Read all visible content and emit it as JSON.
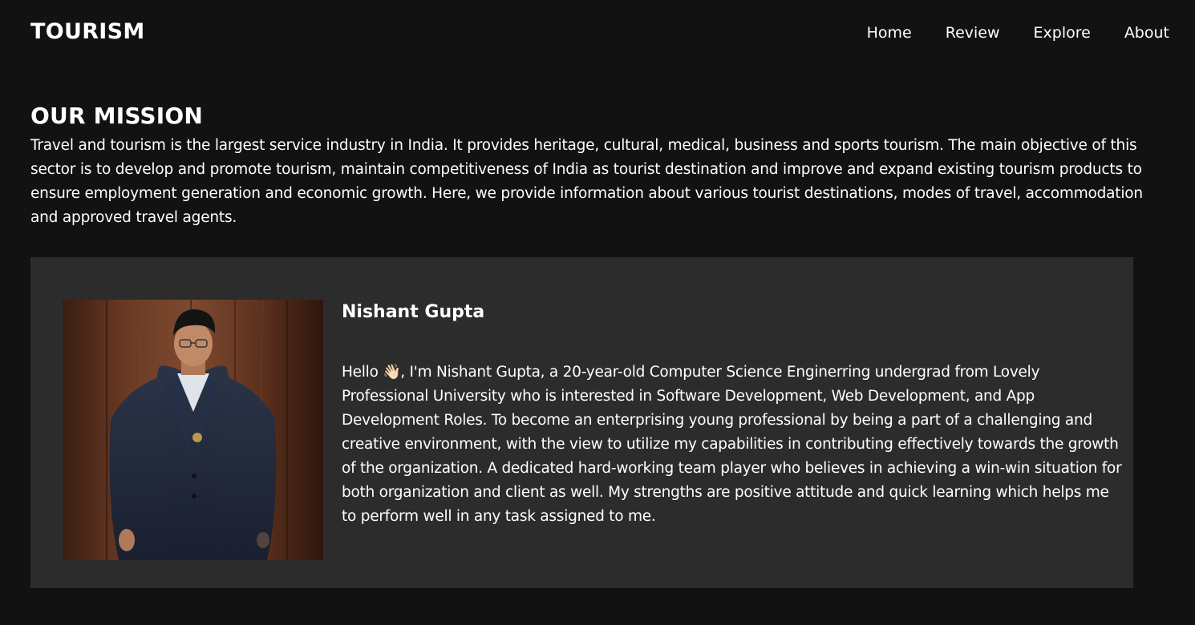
{
  "navbar": {
    "brand": "TOURISM",
    "links": [
      "Home",
      "Review",
      "Explore",
      "About"
    ]
  },
  "mission": {
    "title": "OUR MISSION",
    "text": "Travel and tourism is the largest service industry in India. It provides heritage, cultural, medical, business and sports tourism. The main objective of this sector is to develop and promote tourism, maintain competitiveness of India as tourist destination and improve and expand existing tourism products to ensure employment generation and economic growth. Here, we provide information about various tourist destinations, modes of travel, accommodation and approved travel agents."
  },
  "profile": {
    "name": "Nishant Gupta",
    "bio_greeting": "Hello ",
    "bio_emoji": "👋🏻",
    "bio_text": ", I'm Nishant Gupta, a 20-year-old Computer Science Enginerring undergrad from Lovely Professional University who is interested in Software Development, Web Development, and App Development Roles. To become an enterprising young professional by being a part of a challenging and creative environment, with the view to utilize my capabilities in contributing effectively towards the growth of the organization. A dedicated hard-working team player who believes in achieving a win-win situation for both organization and client as well. My strengths are positive attitude and quick learning which helps me to perform well in any task assigned to me.",
    "photo_icon": "person-photo"
  },
  "colors": {
    "page_background": "#121212",
    "card_background": "#2c2c2c",
    "text": "#ffffff"
  }
}
